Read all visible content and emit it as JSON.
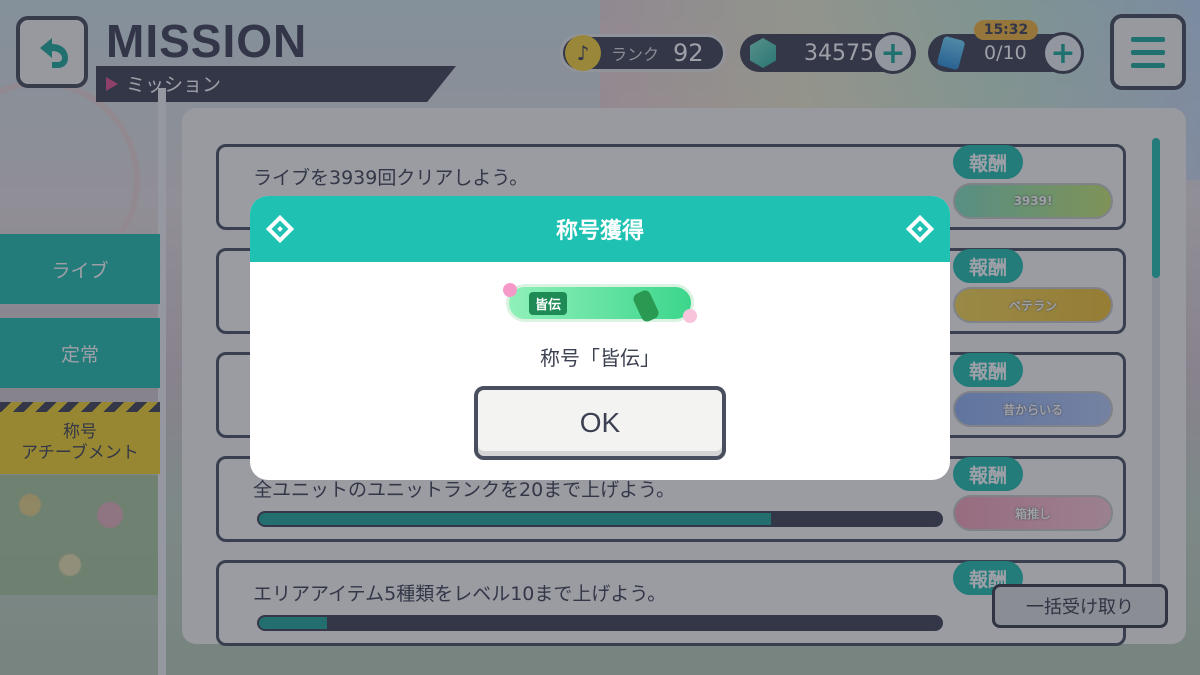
{
  "header": {
    "title": "MISSION",
    "subtitle": "ミッション",
    "rank_label": "ランク",
    "rank_value": "92",
    "gems": "34575",
    "energy": "0/10",
    "energy_timer": "15:32",
    "plus": "+"
  },
  "tabs": [
    {
      "label": "ライブ"
    },
    {
      "label": "定常"
    },
    {
      "label_line1": "称号",
      "label_line2": "アチーブメント"
    }
  ],
  "missions": [
    {
      "text": "ライブを3939回クリアしよう。",
      "reward_label": "報酬",
      "reward_badge": "3939!",
      "progress": null
    },
    {
      "text": "",
      "reward_label": "報酬",
      "reward_badge": "ベテラン",
      "progress": null
    },
    {
      "text": "",
      "reward_label": "報酬",
      "reward_badge": "昔からいる",
      "progress": null
    },
    {
      "text": "全ユニットのユニットランクを20まで上げよう。",
      "reward_label": "報酬",
      "reward_badge": "箱推し",
      "progress": 0.75
    },
    {
      "text": "エリアアイテム5種類をレベル10まで上げよう。",
      "reward_label": "報酬",
      "reward_badge": "",
      "progress": 0.1
    }
  ],
  "bulk_receive": "一括受け取り",
  "modal": {
    "title": "称号獲得",
    "badge_tag": "皆伝",
    "message": "称号「皆伝」",
    "ok": "OK"
  },
  "colors": {
    "accent": "#1fc2b2",
    "dark": "#3c4152",
    "yellow_tab": "#f2d12c"
  }
}
